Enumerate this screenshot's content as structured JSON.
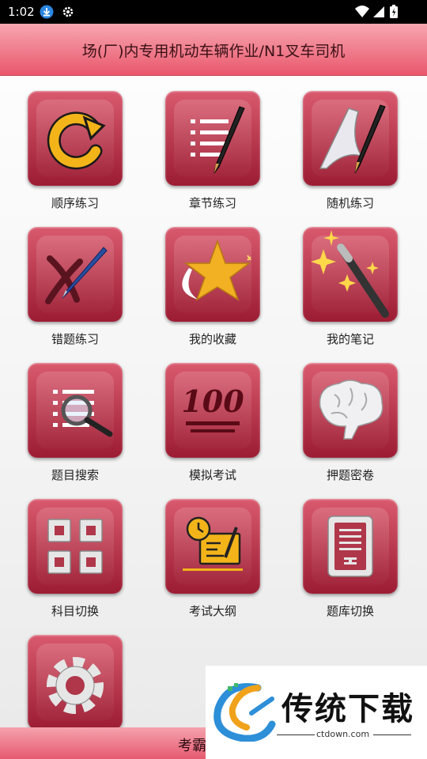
{
  "status_bar": {
    "time": "1:02",
    "icons": [
      "download-icon",
      "gear-icon",
      "wifi-icon",
      "signal-icon",
      "battery-icon"
    ]
  },
  "header": {
    "title": "场(厂)内专用机动车辆作业/N1叉车司机"
  },
  "menu": [
    {
      "label": "顺序练习",
      "icon": "circular-arrow-icon"
    },
    {
      "label": "章节练习",
      "icon": "list-pen-icon"
    },
    {
      "label": "随机练习",
      "icon": "random-pen-icon"
    },
    {
      "label": "错题练习",
      "icon": "cross-pen-icon"
    },
    {
      "label": "我的收藏",
      "icon": "star-icon"
    },
    {
      "label": "我的笔记",
      "icon": "magic-wand-icon"
    },
    {
      "label": "题目搜索",
      "icon": "list-search-icon"
    },
    {
      "label": "模拟考试",
      "icon": "score-100-icon"
    },
    {
      "label": "押题密卷",
      "icon": "brain-icon"
    },
    {
      "label": "科目切换",
      "icon": "grid-icon"
    },
    {
      "label": "考试大纲",
      "icon": "clock-document-icon"
    },
    {
      "label": "题库切换",
      "icon": "document-icon"
    },
    {
      "label": "",
      "icon": "gear-icon"
    }
  ],
  "bottom_bar": {
    "text": "考霸让考试"
  },
  "watermark": {
    "brand": "传统下载",
    "url": "ctdown.com"
  },
  "colors": {
    "header_top": "#f7a6b0",
    "header_bottom": "#e9576c",
    "tile_top": "#d9596d",
    "tile_bottom": "#9b1c33"
  }
}
